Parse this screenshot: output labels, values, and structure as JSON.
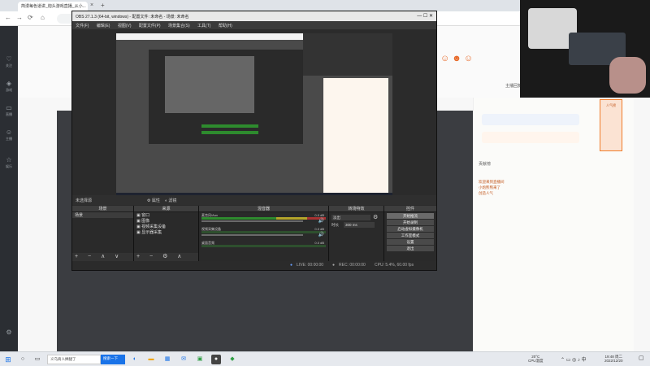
{
  "browser": {
    "tabs": [
      "简漫每色道讲_炮头游戏直播_从小...",
      "",
      ""
    ],
    "active_tab": "简漫每色道讲_炮头游戏直播_从小...",
    "url": "",
    "rail_items": [
      "关注",
      "游戏",
      "直播",
      "主播",
      "娱乐"
    ],
    "notification": "主播回复了您",
    "right_panel": {
      "intro_lines": [
        "欢迎来到直播间",
        "小炮熊熊来了",
        "创造人气"
      ],
      "badge_label": "人气榜",
      "rank_label": "贡献榜"
    }
  },
  "obs": {
    "title": "OBS 27.1.3 (64-bit, windows) - 配置文件: 未命名 - 场景: 未命名",
    "menu": [
      "文件(F)",
      "编辑(E)",
      "视图(V)",
      "配置文件(P)",
      "场景集合(S)",
      "工具(T)",
      "帮助(H)"
    ],
    "scene_bar": {
      "label": "未选择源",
      "properties": "属性",
      "filters": "滤镜"
    },
    "docks": {
      "scenes": {
        "title": "场景",
        "items": [
          "场景"
        ]
      },
      "sources": {
        "title": "来源",
        "items": [
          "窗口",
          "图像",
          "视频采集设备",
          "显示器采集"
        ]
      },
      "mixer": {
        "title": "混音器",
        "channels": [
          {
            "name": "麦克风/Aux",
            "db": "0.0 dB"
          },
          {
            "name": "视频采集设备",
            "db": "0.0 dB"
          },
          {
            "name": "桌面音频",
            "db": "0.0 dB"
          }
        ]
      },
      "transitions": {
        "title": "转场特效",
        "type": "淡出",
        "duration_label": "时长",
        "duration_value": "300 ms"
      },
      "controls": {
        "title": "控件",
        "buttons": [
          "开始推流",
          "开始录制",
          "启动虚拟摄像机",
          "工作室模式",
          "设置",
          "退出"
        ]
      }
    },
    "status": {
      "live": "LIVE: 00:00:00",
      "rec": "REC: 00:00:00",
      "cpu": "CPU: 5.4%, 60.00 fps"
    }
  },
  "taskbar": {
    "search_text": "义乌商人捧腿了",
    "search_button": "搜索一下",
    "weather": "20°C",
    "weather_desc": "CPU温度",
    "time": "19:48 周二",
    "date": "2022/12/20"
  },
  "colors": {
    "accent": "#f07c2a",
    "obs_bg": "#2b2b2b",
    "taskbar": "#e6e9ee"
  }
}
